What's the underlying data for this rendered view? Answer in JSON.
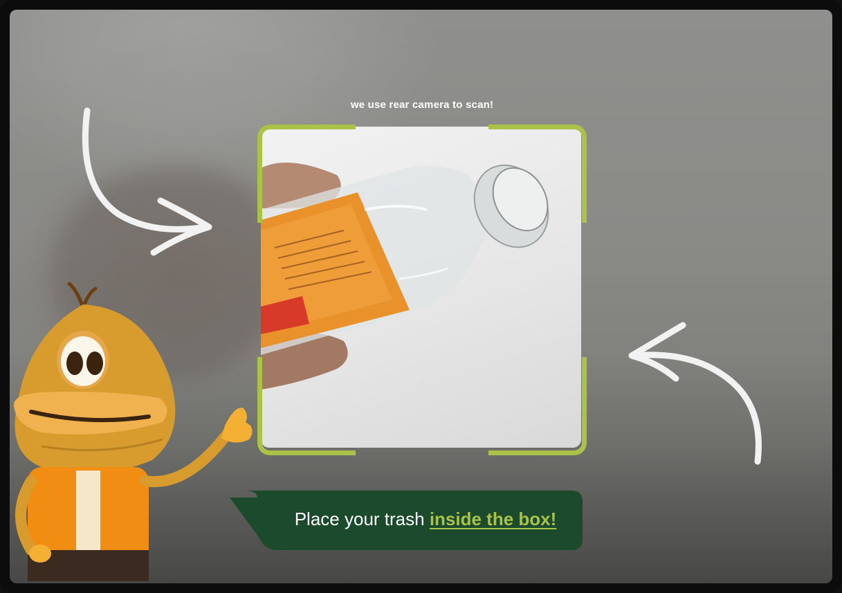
{
  "scanner": {
    "hint": "we use rear camera to scan!",
    "frame_color": "#a9c247"
  },
  "instruction": {
    "prefix": "Place your trash ",
    "highlight": "inside the box!",
    "bubble_color": "#1b4a2c",
    "highlight_color": "#a9c247"
  },
  "icons": {
    "left_arrow": "curved-arrow-right-icon",
    "right_arrow": "curved-arrow-left-icon",
    "mascot": "mascot-character"
  }
}
